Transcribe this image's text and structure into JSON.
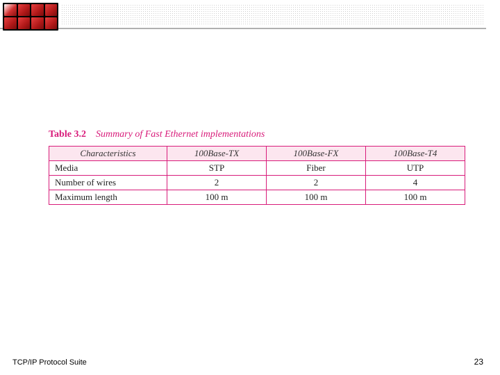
{
  "header": {
    "logo_name": "red-grid-logo"
  },
  "table": {
    "label": "Table 3.2",
    "caption": "Summary of Fast Ethernet implementations",
    "columns": [
      "Characteristics",
      "100Base-TX",
      "100Base-FX",
      "100Base-T4"
    ],
    "rows": [
      {
        "label": "Media",
        "values": [
          "STP",
          "Fiber",
          "UTP"
        ]
      },
      {
        "label": "Number of wires",
        "values": [
          "2",
          "2",
          "4"
        ]
      },
      {
        "label": "Maximum length",
        "values": [
          "100 m",
          "100 m",
          "100 m"
        ]
      }
    ]
  },
  "footer": {
    "left": "TCP/IP Protocol Suite",
    "page": "23"
  },
  "chart_data": {
    "type": "table",
    "title": "Table 3.2 Summary of Fast Ethernet implementations",
    "columns": [
      "Characteristics",
      "100Base-TX",
      "100Base-FX",
      "100Base-T4"
    ],
    "rows": [
      [
        "Media",
        "STP",
        "Fiber",
        "UTP"
      ],
      [
        "Number of wires",
        "2",
        "2",
        "4"
      ],
      [
        "Maximum length",
        "100 m",
        "100 m",
        "100 m"
      ]
    ]
  }
}
